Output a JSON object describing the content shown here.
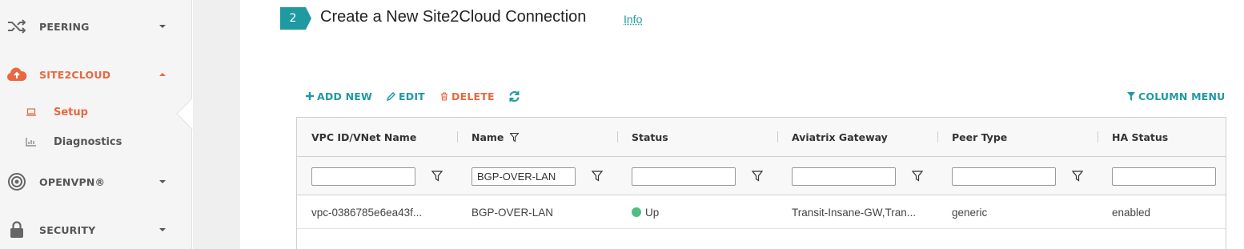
{
  "sidebar": {
    "items": [
      {
        "label": "PEERING",
        "icon": "shuffle-icon"
      },
      {
        "label": "SITE2CLOUD",
        "icon": "cloud-upload-icon"
      },
      {
        "label": "OPENVPN®",
        "icon": "target-icon"
      },
      {
        "label": "SECURITY",
        "icon": "lock-icon"
      }
    ],
    "subitems": [
      {
        "label": "Setup",
        "icon": "laptop-icon"
      },
      {
        "label": "Diagnostics",
        "icon": "bar-chart-icon"
      }
    ]
  },
  "step": {
    "number": "2",
    "title": "Create a New Site2Cloud Connection",
    "info": "Info"
  },
  "toolbar": {
    "add_new": "ADD NEW",
    "edit": "EDIT",
    "delete": "DELETE",
    "column_menu": "COLUMN MENU"
  },
  "table": {
    "columns": [
      "VPC ID/VNet Name",
      "Name",
      "Status",
      "Aviatrix Gateway",
      "Peer Type",
      "HA Status"
    ],
    "filters": [
      "",
      "BGP-OVER-LAN",
      "",
      "",
      "",
      ""
    ],
    "rows": [
      {
        "vpc": "vpc-0386785e6ea43f...",
        "name": "BGP-OVER-LAN",
        "status": "Up",
        "gateway": "Transit-Insane-GW,Tran...",
        "peer_type": "generic",
        "ha_status": "enabled"
      }
    ]
  },
  "colors": {
    "accent": "#1f9aa0",
    "active": "#e8683f",
    "status_up": "#4fbf7e"
  }
}
